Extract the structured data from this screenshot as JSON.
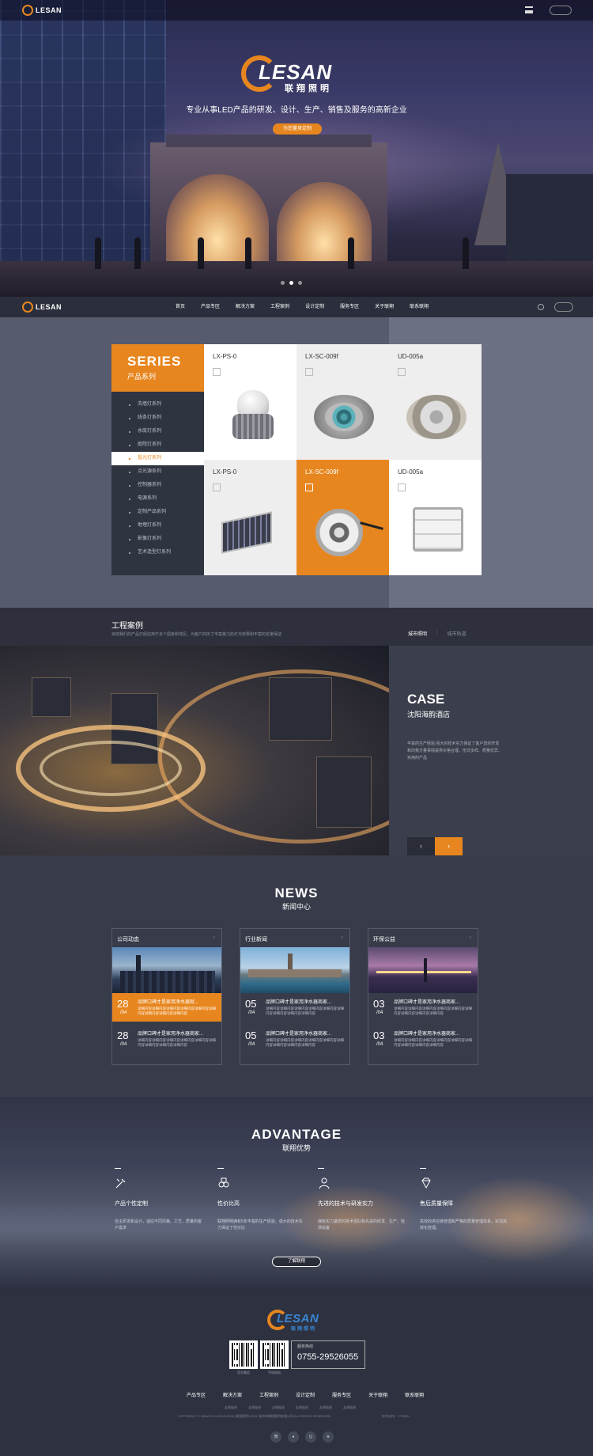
{
  "brand": {
    "wordmark": "LESAN",
    "chinese": "联翔照明",
    "accent_color": "#e7861f"
  },
  "hero": {
    "slogan": "专业从事LED产品的研发、设计、生产、销售及服务的高新企业",
    "cta_label": "为您量身定制"
  },
  "topbar": {
    "menu_icon": "hamburger-icon",
    "search_icon": "search-icon"
  },
  "nav": {
    "items": [
      "首页",
      "产品专区",
      "解决方案",
      "工程案例",
      "设计定制",
      "服务专区",
      "关于联翔",
      "联系联翔"
    ]
  },
  "products": {
    "series_en": "SERIES",
    "series_cn": "产品系列",
    "categories": [
      "洗墙灯系列",
      "线条灯系列",
      "水底灯系列",
      "庭院灯系列",
      "投光灯系列",
      "点光源系列",
      "控制器系列",
      "电源系列",
      "定制产品系列",
      "地埋灯系列",
      "影像灯系列",
      "艺术造型灯系列"
    ],
    "active_category": "投光灯系列",
    "items": [
      {
        "name": "LX-PS-0"
      },
      {
        "name": "LX-SC-009f"
      },
      {
        "name": "UD-005a"
      },
      {
        "name": "LX-PS-0"
      },
      {
        "name": "LX-SC-009f"
      },
      {
        "name": "UD-005a"
      }
    ]
  },
  "cases": {
    "title": "工程案例",
    "subtitle": "目前我们的产品已经应用于多个国家和地区，为客户的庆了丰富量力的灯光效果和丰富的定量保证",
    "tabs": [
      "城市照明",
      "城市轨道"
    ],
    "active_tab": "城市照明",
    "case_en": "CASE",
    "case_cn": "沈阳海韵酒店",
    "description": "丰富的生产经验,强大的技术实力保证了客户您的开发和向我方量事情提供价格合理、形式多样、质量优异、实用的产品",
    "prev_label": "‹",
    "next_label": "›"
  },
  "news": {
    "en": "NEWS",
    "cn": "新闻中心",
    "columns": [
      {
        "title": "公司动态",
        "items": [
          {
            "day": "28",
            "month": "/04",
            "title": "品牌口碑才是家用净水器就...",
            "text": "详细内容详细内容详细内容详细内容详细内容详细内容详细内容详细内容详细内容"
          },
          {
            "day": "28",
            "month": "/04",
            "title": "品牌口碑才是家用净水器商家...",
            "text": "详细内容详细内容详细内容详细内容详细内容详细内容详细内容详细内容详细内容"
          }
        ]
      },
      {
        "title": "行业新闻",
        "items": [
          {
            "day": "05",
            "month": "/04",
            "title": "品牌口碑才是家用净水器商家...",
            "text": "详细内容详细内容详细内容详细内容详细内容详细内容详细内容详细内容详细内容"
          },
          {
            "day": "05",
            "month": "/04",
            "title": "品牌口碑才是家用净水器商家...",
            "text": "详细内容详细内容详细内容详细内容详细内容详细内容详细内容详细内容详细内容"
          }
        ]
      },
      {
        "title": "环保公益",
        "items": [
          {
            "day": "03",
            "month": "/04",
            "title": "品牌口碑才是家用净水器商家...",
            "text": "详细内容详细内容详细内容详细内容详细内容详细内容详细内容详细内容详细内容"
          },
          {
            "day": "03",
            "month": "/04",
            "title": "品牌口碑才是家用净水器商家...",
            "text": "详细内容详细内容详细内容详细内容详细内容详细内容详细内容详细内容详细内容"
          }
        ]
      }
    ],
    "more_icon": "chevron-right-icon"
  },
  "advantage": {
    "en": "ADVANTAGE",
    "cn": "联翔优势",
    "items": [
      {
        "title": "产品个性定制",
        "text": "自主研发和设计，适应不同风格、工艺、质量的客户需求",
        "icon": "customize-icon"
      },
      {
        "title": "性价比高",
        "text": "联翔照明拥有5年丰富的生产经验，强大的技术实力保证了性价比",
        "icon": "value-icon"
      },
      {
        "title": "先进的技术与研发实力",
        "text": "拥有实力雄厚的技术团队和先进的研发、生产、检测设备",
        "icon": "team-icon"
      },
      {
        "title": "售后质量保障",
        "text": "高效的供应链管理和严格的质量管理体系，实现高效化管理。",
        "icon": "diamond-icon"
      }
    ],
    "button_label": "了解联翔"
  },
  "footer": {
    "qr_captions": [
      "官方微信",
      "手机网站"
    ],
    "hotline_label": "服务热线",
    "hotline_number": "0755-29526055",
    "nav": [
      "产品专区",
      "解决方案",
      "工程案例",
      "设计定制",
      "服务专区",
      "关于联翔",
      "联系联翔"
    ],
    "sub_links": [
      "友情链接",
      "友情链接",
      "友情链接",
      "友情链接",
      "友情链接",
      "友情链接"
    ],
    "copyright": "COPYRIGHT © WWW.SZ-LESAN.COM (联翔照明) 2011 深圳市联翔照明有限公司 ALL RIGHTS RESERVED.",
    "tech_support": "技术支持：CTMON",
    "socials": [
      "weibo-icon",
      "wechat-icon",
      "qq-icon",
      "star-icon"
    ]
  }
}
